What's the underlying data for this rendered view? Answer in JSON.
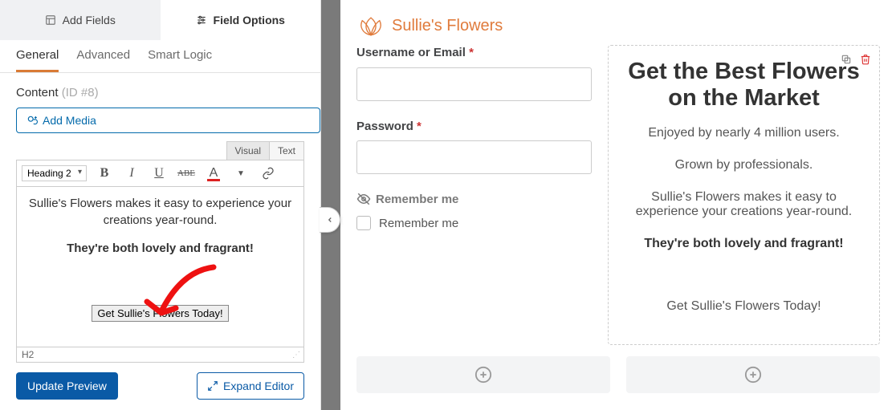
{
  "sidebar": {
    "top_tabs": {
      "add_fields": "Add Fields",
      "field_options": "Field Options"
    },
    "sub_tabs": {
      "general": "General",
      "advanced": "Advanced",
      "smart_logic": "Smart Logic"
    },
    "content_label": "Content",
    "content_id": "(ID #8)",
    "add_media": "Add Media",
    "editor_tabs": {
      "visual": "Visual",
      "text": "Text"
    },
    "format_select": "Heading 2",
    "editor": {
      "line1": "Sullie's Flowers makes it easy to experience your creations year-round.",
      "line2": "They're both lovely and fragrant!",
      "button": "Get Sullie's Flowers Today!"
    },
    "status": "H2",
    "update_preview": "Update Preview",
    "expand_editor": "Expand Editor"
  },
  "preview": {
    "brand": "Sullie's Flowers",
    "left": {
      "username_label": "Username or Email",
      "password_label": "Password",
      "remember_header": "Remember me",
      "remember_check": "Remember me"
    },
    "right": {
      "title": "Get the Best Flowers on the Market",
      "p1": "Enjoyed by nearly 4 million users.",
      "p2": "Grown by professionals.",
      "p3": "Sullie's Flowers makes it easy to experience your creations year-round.",
      "p4": "They're both lovely and fragrant!",
      "p5": "Get Sullie's Flowers Today!"
    }
  }
}
